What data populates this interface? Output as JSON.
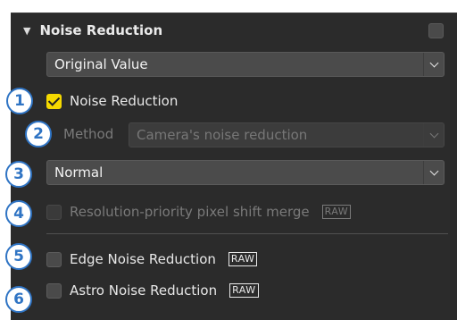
{
  "section": {
    "title": "Noise Reduction",
    "collapse_glyph": "▼"
  },
  "preset_select": {
    "value": "Original Value"
  },
  "noise_reduction": {
    "label": "Noise Reduction",
    "checked": true
  },
  "method": {
    "label": "Method",
    "value": "Camera's noise reduction"
  },
  "strength_select": {
    "value": "Normal"
  },
  "pixel_shift": {
    "label": "Resolution-priority pixel shift merge",
    "badge": "RAW"
  },
  "edge_nr": {
    "label": "Edge Noise Reduction",
    "badge": "RAW"
  },
  "astro_nr": {
    "label": "Astro Noise Reduction",
    "badge": "RAW"
  },
  "callouts": [
    "1",
    "2",
    "3",
    "4",
    "5",
    "6"
  ],
  "colors": {
    "accent": "#f5d900",
    "callout": "#2f74c4",
    "panel": "#2b2b2b"
  }
}
